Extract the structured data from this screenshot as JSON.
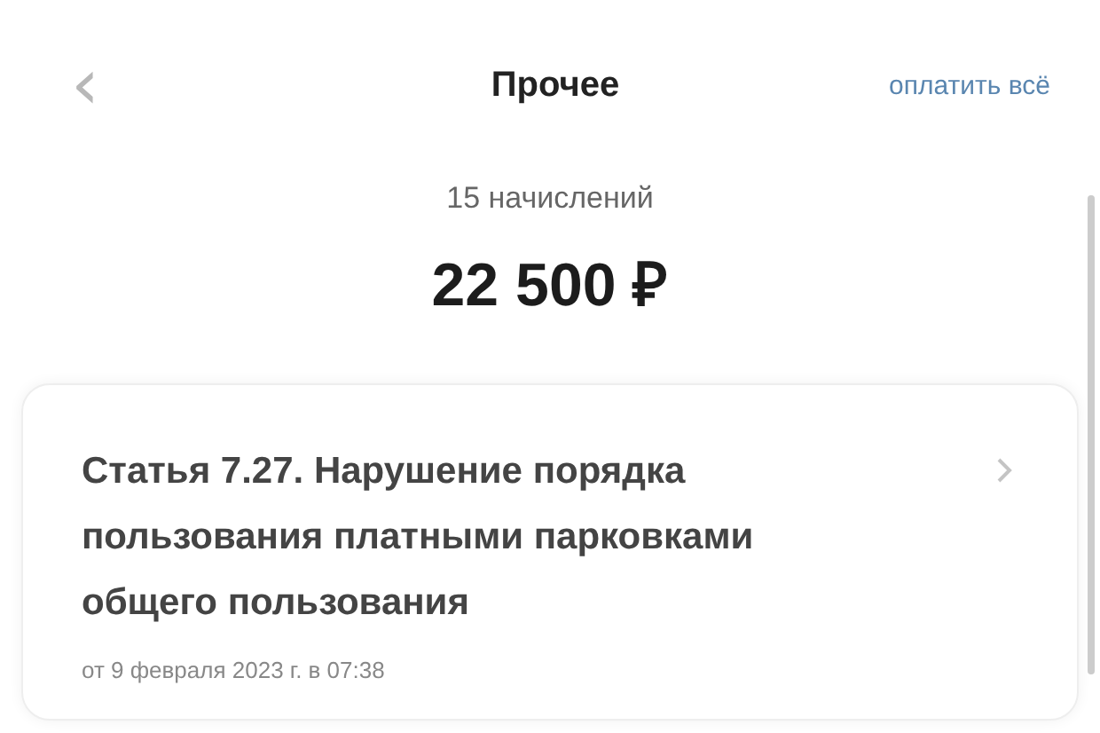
{
  "header": {
    "back": "‹",
    "title": "Прочее",
    "action": "оплатить всё"
  },
  "summary": {
    "count": "15 начислений",
    "amount": "22 500 ₽"
  },
  "charges": [
    {
      "title": "Статья 7.27. Нарушение порядка пользования платными парковками общего пользования",
      "date": "от 9 февраля 2023 г. в 07:38"
    }
  ]
}
